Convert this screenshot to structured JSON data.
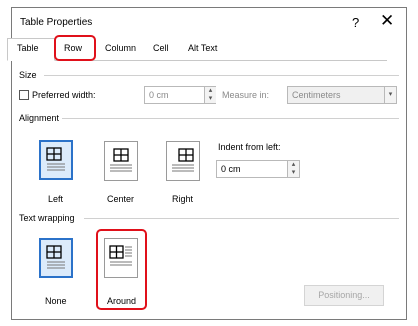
{
  "dialog": {
    "title": "Table Properties",
    "help_label": "?",
    "close_label": "✕"
  },
  "tabs": [
    {
      "label": "Table",
      "active": true
    },
    {
      "label": "Row",
      "highlighted": true
    },
    {
      "label": "Column"
    },
    {
      "label": "Cell"
    },
    {
      "label": "Alt Text"
    }
  ],
  "size": {
    "section_label": "Size",
    "preferred_width_label": "Preferred width:",
    "preferred_width_checked": false,
    "width_value": "0 cm",
    "measure_in_label": "Measure in:",
    "measure_in_value": "Centimeters"
  },
  "alignment": {
    "section_label": "Alignment",
    "options": [
      {
        "label": "Left",
        "selected": true
      },
      {
        "label": "Center"
      },
      {
        "label": "Right"
      }
    ],
    "indent_label": "Indent from left:",
    "indent_value": "0 cm"
  },
  "text_wrapping": {
    "section_label": "Text wrapping",
    "options": [
      {
        "label": "None",
        "selected": true
      },
      {
        "label": "Around",
        "highlighted": true
      }
    ],
    "positioning_label": "Positioning..."
  },
  "colors": {
    "highlight": "#e0101a",
    "selected_border": "#2b72c9",
    "selected_fill": "#dcebfb"
  }
}
